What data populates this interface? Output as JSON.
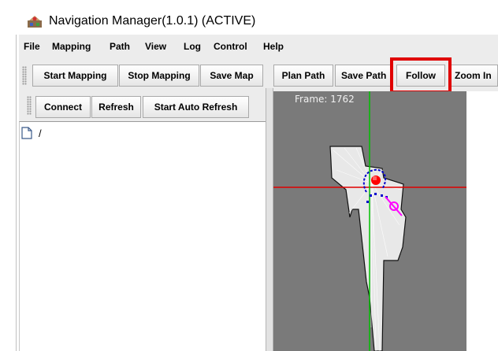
{
  "window": {
    "title": "Navigation Manager(1.0.1) (ACTIVE)",
    "icon": "robot-app-icon"
  },
  "menu": [
    "File",
    "Mapping",
    "Path",
    "View",
    "Log",
    "Control",
    "Help"
  ],
  "toolbar": {
    "start_mapping": "Start Mapping",
    "stop_mapping": "Stop Mapping",
    "save_map": "Save Map",
    "plan_path": "Plan Path",
    "save_path": "Save Path",
    "follow": "Follow",
    "zoom_in": "Zoom In"
  },
  "left_toolbar": {
    "connect": "Connect",
    "refresh": "Refresh",
    "start_auto_refresh": "Start Auto Refresh"
  },
  "tree": {
    "root_label": "/",
    "root_icon": "file-icon"
  },
  "map": {
    "frame_text": "Frame: 1762",
    "background_color": "#7a7a7a",
    "axis_x_color": "#e00000",
    "axis_y_color": "#00c000",
    "path_color": "#0000cc",
    "goal_color": "#ff00ff",
    "robot_color": "#ff0000"
  },
  "highlight_color": "#e00000"
}
